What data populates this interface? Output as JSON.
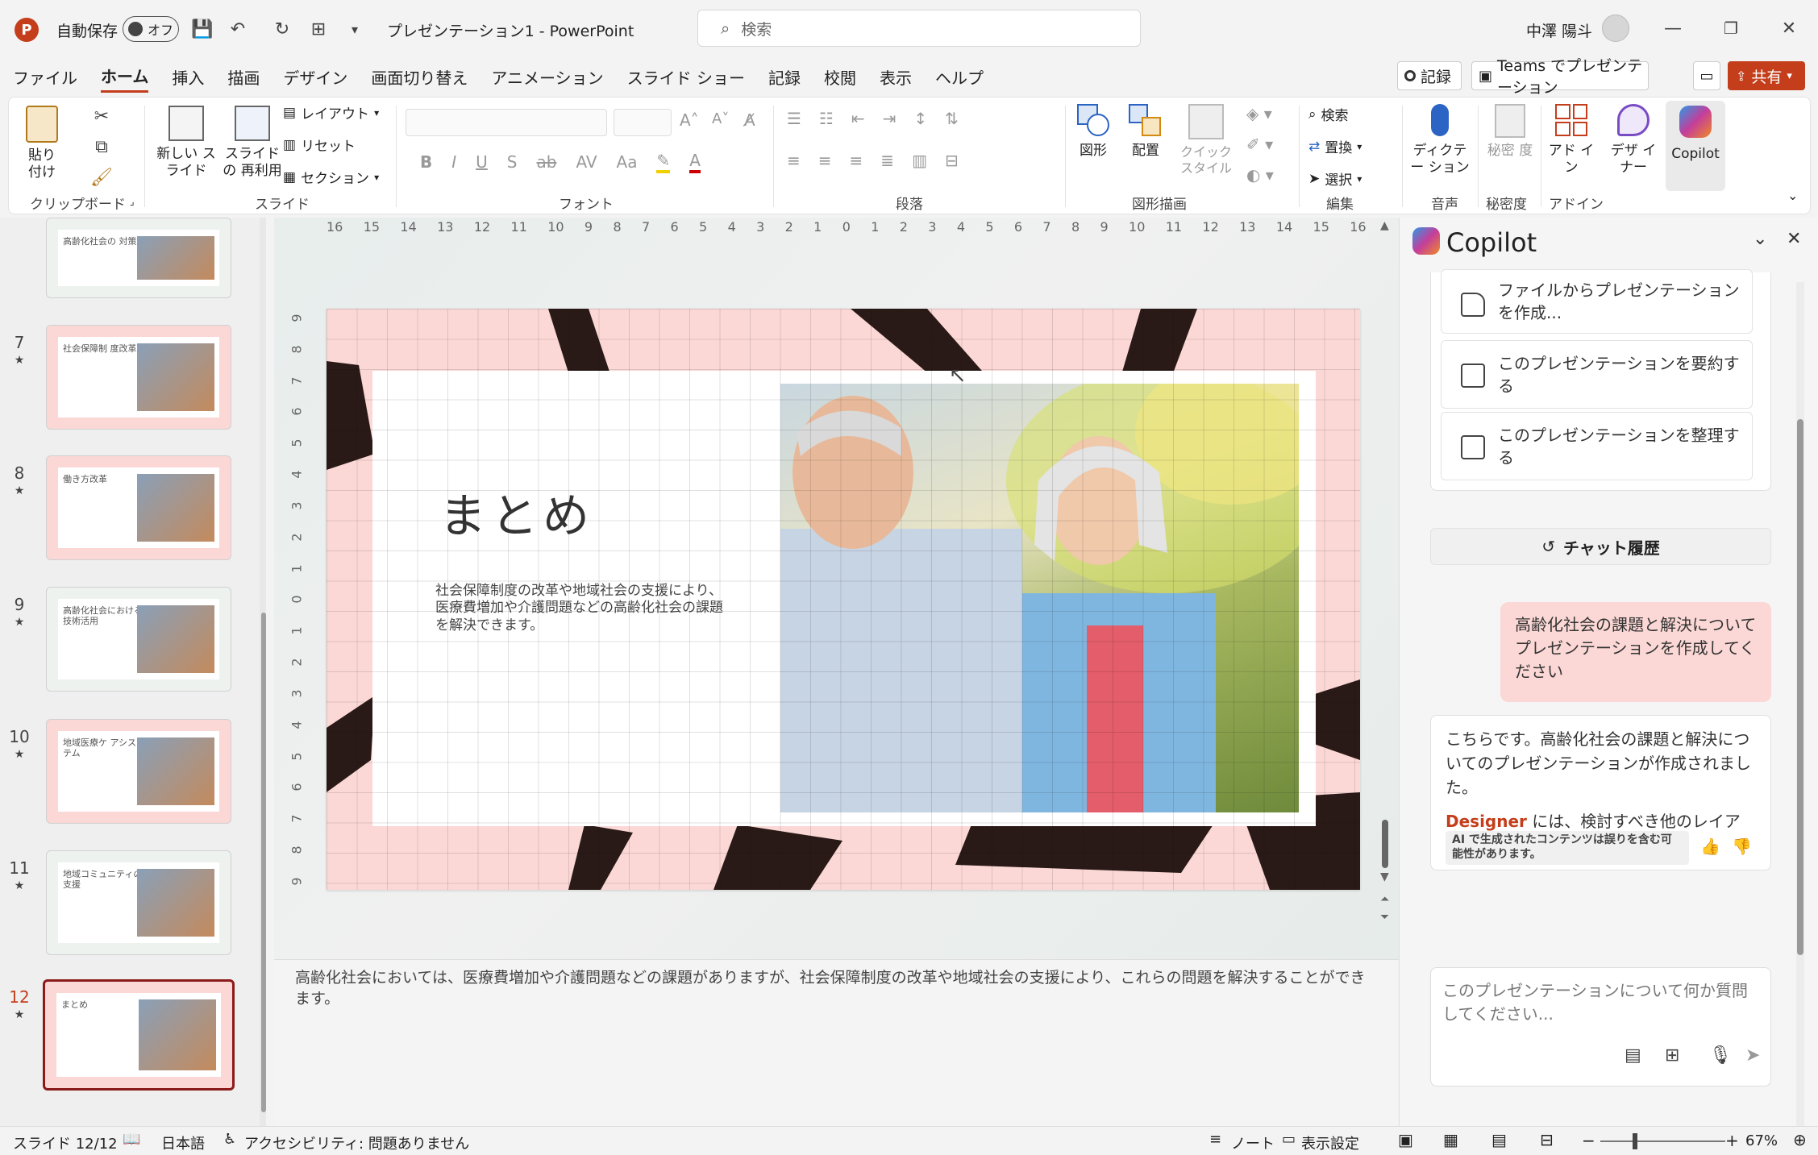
{
  "app": {
    "autosave_label": "自動保存",
    "autosave_state": "オフ",
    "document_title": "プレゼンテーション1 - PowerPoint",
    "search_placeholder": "検索",
    "user_name": "中澤 陽斗"
  },
  "menu": [
    "ファイル",
    "ホーム",
    "挿入",
    "描画",
    "デザイン",
    "画面切り替え",
    "アニメーション",
    "スライド ショー",
    "記録",
    "校閲",
    "表示",
    "ヘルプ"
  ],
  "menu_active": "ホーム",
  "menu_right": {
    "record": "記録",
    "teams": "Teams でプレゼンテーション",
    "share": "共有"
  },
  "ribbon": {
    "clipboard": {
      "paste": "貼り付け",
      "label": "クリップボード"
    },
    "slides": {
      "new_slide": "新しい スライド",
      "reuse": "スライドの 再利用",
      "layout": "レイアウト",
      "reset": "リセット",
      "section": "セクション",
      "label": "スライド"
    },
    "font": {
      "label": "フォント",
      "bold": "B",
      "italic": "I",
      "underline": "U",
      "shadow": "S",
      "strike": "ab",
      "spacing": "AV",
      "case": "Aa"
    },
    "paragraph": {
      "label": "段落"
    },
    "drawing": {
      "shapes": "図形",
      "arrange": "配置",
      "quick_style": "クイック スタイル",
      "label": "図形描画"
    },
    "editing": {
      "find": "検索",
      "replace": "置換",
      "select": "選択",
      "label": "編集"
    },
    "voice": {
      "dictate": "ディクテー ション",
      "label": "音声"
    },
    "sensitivity": {
      "button": "秘密 度",
      "label": "秘密度"
    },
    "addins": {
      "button": "アド イン",
      "label": "アドイン"
    },
    "designer": {
      "button": "デザ イナー"
    },
    "copilot": {
      "button": "Copilot"
    }
  },
  "thumbnails": [
    {
      "num": "",
      "title": "高齢化社会の 対策"
    },
    {
      "num": "7",
      "title": "社会保障制 度改革"
    },
    {
      "num": "8",
      "title": "働き方改革"
    },
    {
      "num": "9",
      "title": "高齢化社会における 技術活用"
    },
    {
      "num": "10",
      "title": "地域医療ケ アシステム"
    },
    {
      "num": "11",
      "title": "地域コミュニティの 支援"
    },
    {
      "num": "12",
      "title": "まとめ"
    }
  ],
  "ruler": {
    "h": [
      "16",
      "15",
      "14",
      "13",
      "12",
      "11",
      "10",
      "9",
      "8",
      "7",
      "6",
      "5",
      "4",
      "3",
      "2",
      "1",
      "0",
      "1",
      "2",
      "3",
      "4",
      "5",
      "6",
      "7",
      "8",
      "9",
      "10",
      "11",
      "12",
      "13",
      "14",
      "15",
      "16"
    ],
    "v": [
      "9",
      "8",
      "7",
      "6",
      "5",
      "4",
      "3",
      "2",
      "1",
      "0",
      "1",
      "2",
      "3",
      "4",
      "5",
      "6",
      "7",
      "8",
      "9"
    ]
  },
  "slide": {
    "title": "まとめ",
    "body": "社会保障制度の改革や地域社会の支援により、医療費増加や介護問題などの高齢化社会の課題を解決できます。"
  },
  "notes": "高齢化社会においては、医療費増加や介護問題などの課題がありますが、社会保障制度の改革や地域社会の支援により、これらの問題を解決することができます。",
  "copilot": {
    "title": "Copilot",
    "suggestions": [
      "ファイルからプレゼンテーションを作成...",
      "このプレゼンテーションを要約する",
      "このプレゼンテーションを整理する"
    ],
    "chat_history": "チャット履歴",
    "user_message": "高齢化社会の課題と解決についてプレゼンテーションを作成してください",
    "reply_main": "こちらです。高齢化社会の課題と解決についてのプレゼンテーションが作成されました。",
    "reply_designer_word": "Designer",
    "reply_designer_rest": " には、検討すべき他のレイアウト オプションもあります。",
    "disclaimer": "AI で生成されたコンテンツは誤りを含む可能性があります。",
    "input_placeholder": "このプレゼンテーションについて何か質問してください..."
  },
  "status": {
    "slide_count": "スライド 12/12",
    "language": "日本語",
    "accessibility": "アクセシビリティ: 問題ありません",
    "notes": "ノート",
    "display_settings": "表示設定",
    "zoom": "67%"
  },
  "colors": {
    "accent": "#c43e1c",
    "slide_pink": "#fbd8d6",
    "brush": "#2a1a17",
    "designer": "#c43e1c"
  }
}
